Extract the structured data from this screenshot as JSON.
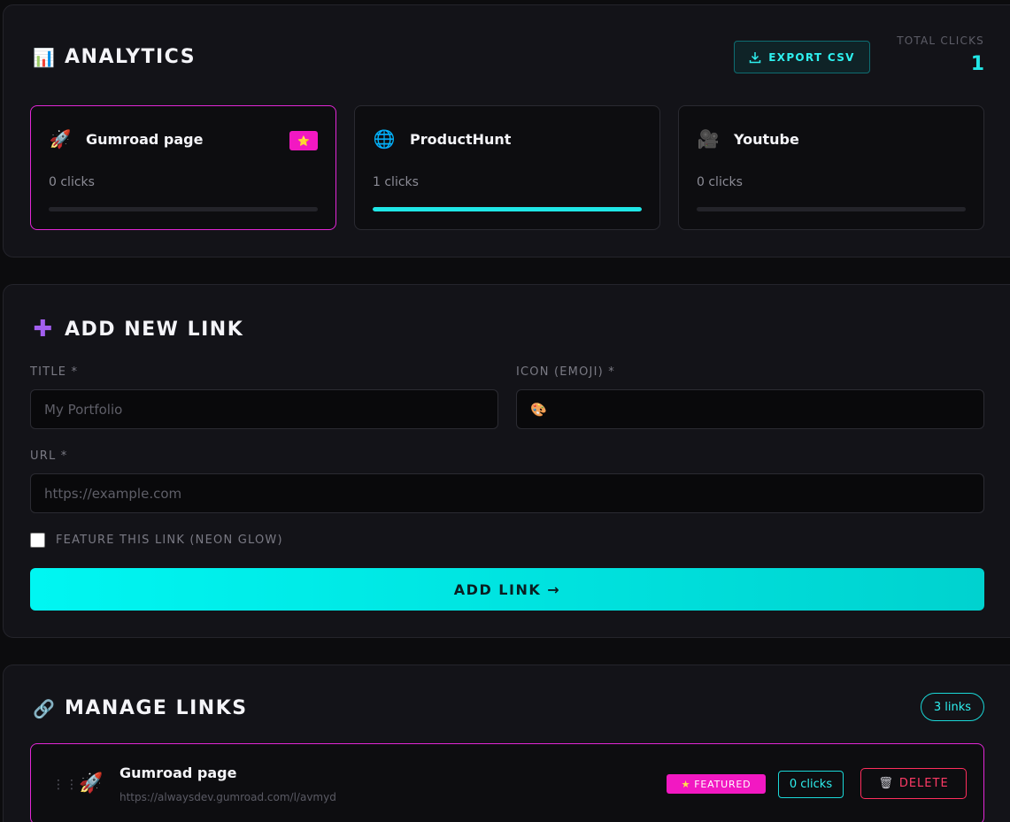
{
  "analytics": {
    "title": "ANALYTICS",
    "icon": "bar-chart-icon",
    "export_label": "EXPORT CSV",
    "total_label": "TOTAL CLICKS",
    "total_value": "1",
    "cards": [
      {
        "title": "Gumroad page",
        "emoji": "🚀",
        "clicks": "0 clicks",
        "featured": true,
        "badge": "⭐",
        "progress": 0
      },
      {
        "title": "ProductHunt",
        "emoji": "🌐",
        "clicks": "1 clicks",
        "featured": false,
        "progress": 1.0
      },
      {
        "title": "Youtube",
        "emoji": "🎥",
        "clicks": "0 clicks",
        "featured": false,
        "progress": 0
      }
    ]
  },
  "add_link": {
    "title": "ADD NEW LINK",
    "icon": "plus-icon",
    "title_label": "TITLE *",
    "title_placeholder": "My Portfolio",
    "icon_label": "ICON (EMOJI) *",
    "icon_value": "🎨",
    "url_label": "URL *",
    "url_placeholder": "https://example.com",
    "feature_label": "FEATURE THIS LINK (NEON GLOW)",
    "feature_checked": false,
    "submit_label": "ADD LINK →"
  },
  "manage": {
    "title": "MANAGE LINKS",
    "icon": "link-icon",
    "count": "3 links",
    "rows": [
      {
        "emoji": "🚀",
        "title": "Gumroad page",
        "url": "https://alwaysdev.gumroad.com/l/avmyd",
        "featured_label": "FEATURED",
        "clicks": "0 clicks",
        "delete_label": "DELETE"
      }
    ]
  },
  "colors": {
    "accent_cyan": "#1fe6e6",
    "accent_magenta": "#e227d6",
    "danger": "#ff2e5d",
    "background": "#0c0c0e"
  }
}
